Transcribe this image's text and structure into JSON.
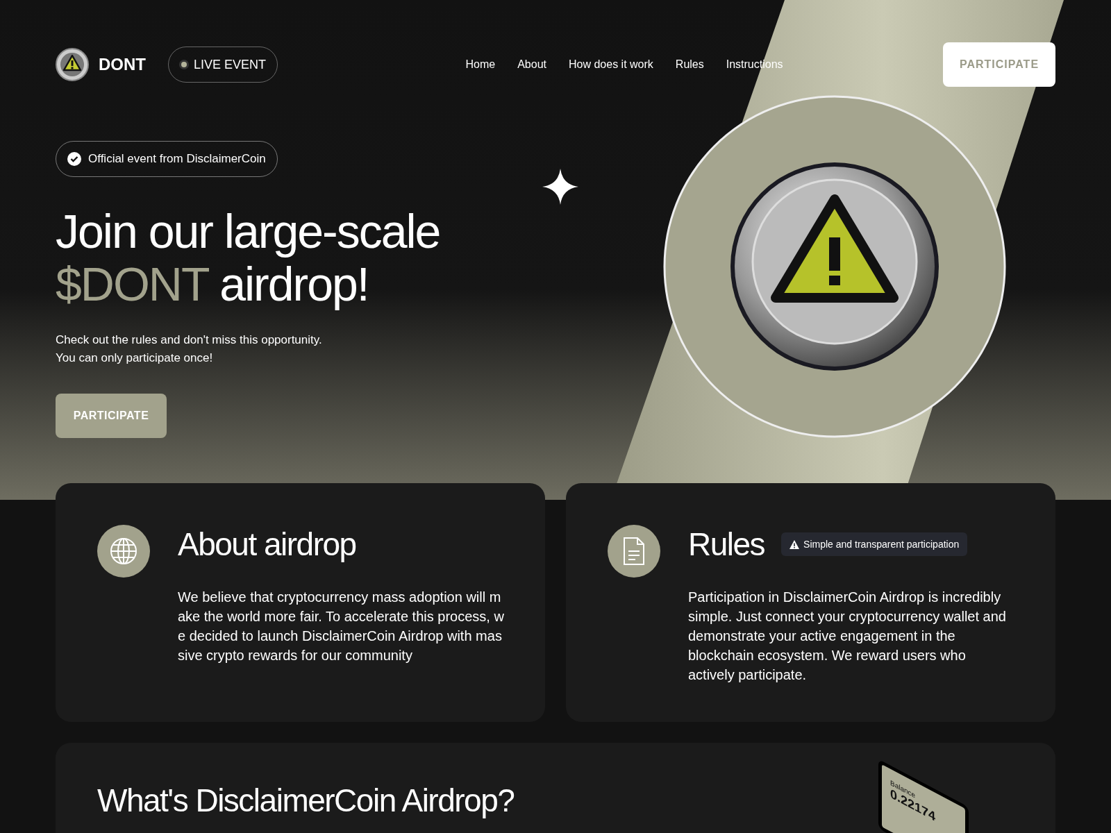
{
  "brand": {
    "name": "DONT"
  },
  "live_badge": {
    "label": "LIVE EVENT",
    "on": true
  },
  "nav": [
    {
      "label": "Home"
    },
    {
      "label": "About"
    },
    {
      "label": "How does it work"
    },
    {
      "label": "Rules"
    },
    {
      "label": "Instructions"
    }
  ],
  "header_button": "PARTICIPATE",
  "hero": {
    "official_badge": "Official event from DisclaimerCoin",
    "title_line_1": "Join our large-scale",
    "title_accent": "$DONT",
    "title_rest": "airdrop!",
    "subtitle_lines": [
      "Check out the rules and don't miss this opportunity.",
      "You can only participate once!"
    ],
    "button": "PARTICIPATE"
  },
  "cards": [
    {
      "kind": "globe",
      "title": "About airdrop",
      "text": "We believe that cryptocurrency mass adoption will make the world more fair. To accelerate this process, we decided to launch DisclaimerCoin Airdrop with massive crypto rewards for our community"
    },
    {
      "kind": "document",
      "title": "Rules",
      "tag": "Simple and transparent participation",
      "text": "Participation in DisclaimerCoin Airdrop is incredibly simple. Just connect your cryptocurrency wallet and demonstrate your active engagement in the blockchain ecosystem. We reward users who actively participate."
    }
  ],
  "section": {
    "title": "What's DisclaimerCoin Airdrop?",
    "phone": {
      "label": "Balance",
      "value": "0.22174"
    }
  }
}
